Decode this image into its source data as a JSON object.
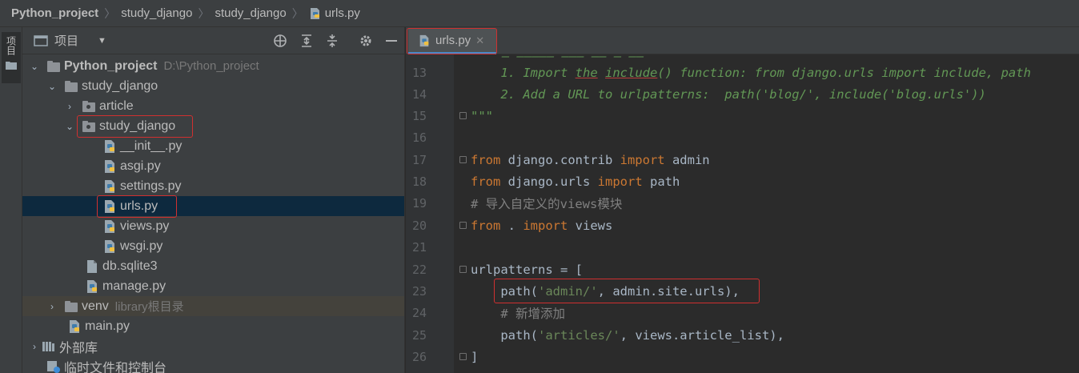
{
  "breadcrumb": [
    "Python_project",
    "study_django",
    "study_django",
    "urls.py"
  ],
  "tool_strip": {
    "project_label": "项目"
  },
  "panel": {
    "title": "项目"
  },
  "tree": [
    {
      "label": "Python_project",
      "hint": "D:\\Python_project"
    },
    {
      "label": "study_django"
    },
    {
      "label": "article"
    },
    {
      "label": "study_django"
    },
    {
      "label": "__init__.py"
    },
    {
      "label": "asgi.py"
    },
    {
      "label": "settings.py"
    },
    {
      "label": "urls.py"
    },
    {
      "label": "views.py"
    },
    {
      "label": "wsgi.py"
    },
    {
      "label": "db.sqlite3"
    },
    {
      "label": "manage.py"
    },
    {
      "label": "venv",
      "hint": "library根目录"
    },
    {
      "label": "main.py"
    },
    {
      "label": "外部库"
    },
    {
      "label": "临时文件和控制台"
    }
  ],
  "editor": {
    "tab_label": "urls.py",
    "line_numbers": [
      "13",
      "14",
      "15",
      "16",
      "17",
      "18",
      "19",
      "20",
      "21",
      "22",
      "23",
      "24",
      "25",
      "26"
    ],
    "code": {
      "l13_a": "    1. Import ",
      "l13_b": "the",
      "l13_c": " ",
      "l13_d": "include",
      "l13_e": "() function: from django.urls import include, path",
      "l14": "    2. Add a URL to urlpatterns:  path('blog/', include('blog.urls'))",
      "l15": "\"\"\"",
      "l17_kw1": "from",
      "l17_a": " django.contrib ",
      "l17_kw2": "import",
      "l17_b": " admin",
      "l18_kw1": "from",
      "l18_a": " django.urls ",
      "l18_kw2": "import",
      "l18_b": " path",
      "l19": "# 导入自定义的views模块",
      "l20_kw1": "from",
      "l20_a": " . ",
      "l20_kw2": "import",
      "l20_b": " views",
      "l22": "urlpatterns = [",
      "l23_a": "    path(",
      "l23_str": "'admin/'",
      "l23_b": ", admin.site.urls),",
      "l24": "    # 新增添加",
      "l25_a": "    path(",
      "l25_str": "'articles/'",
      "l25_b": ", views.article_list),",
      "l26": "]"
    }
  },
  "colors": {
    "keyword": "#cc7832",
    "string": "#6a8759",
    "comment": "#808080",
    "docstring": "#629755",
    "highlight_box": "#d03030",
    "selection": "#0d293e"
  }
}
